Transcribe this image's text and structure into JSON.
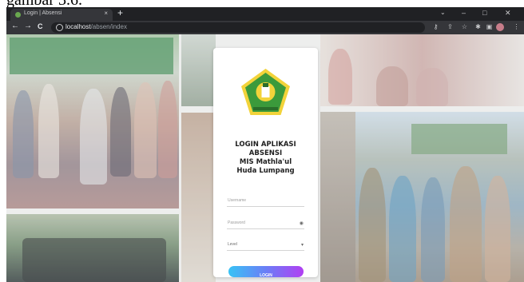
{
  "document": {
    "caption_fragment": "gambar 3.6."
  },
  "browser": {
    "tab": {
      "title": "Login | Absensi",
      "favicon": "school-logo-icon",
      "close": "×"
    },
    "new_tab": "+",
    "window_controls": {
      "chevron": "⌄",
      "minimize": "–",
      "maximize": "□",
      "close": "✕"
    },
    "nav": {
      "back": "←",
      "forward": "→",
      "reload": "C"
    },
    "address": {
      "host": "localhost",
      "path": "/absen/index"
    },
    "toolbar_icons": [
      "key-icon",
      "share-icon",
      "star-icon",
      "extensions-icon",
      "sidebar-icon",
      "profile-icon",
      "menu-icon"
    ]
  },
  "login": {
    "title_lines": [
      "LOGIN APLIKASI",
      "ABSENSI",
      "MIS Mathla'ul",
      "Huda Lumpang"
    ],
    "username_placeholder": "Username",
    "password_placeholder": "Password",
    "role_value": "Level",
    "button_label": "LOGIN"
  },
  "colors": {
    "logo_green": "#3b9a3b",
    "logo_yellow": "#f2d33a",
    "button_start": "#38c3f5",
    "button_end": "#b13ff2"
  }
}
